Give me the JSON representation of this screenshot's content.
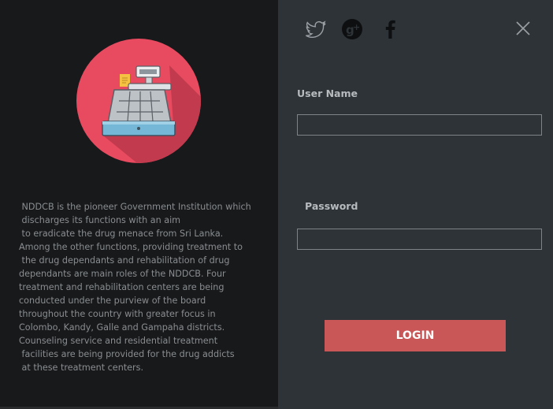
{
  "left": {
    "logo_icon": "cash-register-icon",
    "description": " NDDCB is the pioneer Government Institution which\n discharges its functions with an aim\n to eradicate the drug menace from Sri Lanka.\nAmong the other functions, providing treatment to\n the drug dependants and rehabilitation of drug\ndependants are main roles of the NDDCB. Four\ntreatment and rehabilitation centers are being\nconducted under the purview of the board\nthroughout the country with greater focus in\nColombo, Kandy, Galle and Gampaha districts.\nCounseling service and residential treatment\n facilities are being provided for the drug addicts\n at these treatment centers.",
    "colors": {
      "background": "#17191b",
      "logo_circle": "#e84a5f",
      "text": "#8a8d90"
    }
  },
  "social": [
    {
      "icon": "twitter-icon"
    },
    {
      "icon": "google-plus-icon"
    },
    {
      "icon": "facebook-icon"
    }
  ],
  "close_icon": "close-icon",
  "form": {
    "username_label": "User Name",
    "username_value": "",
    "password_label": "Password",
    "password_value": "",
    "login_label": "LOGIN"
  },
  "colors": {
    "panel_background": "#2d3337",
    "login_button": "#c95757",
    "field_border": "#7d8387"
  }
}
